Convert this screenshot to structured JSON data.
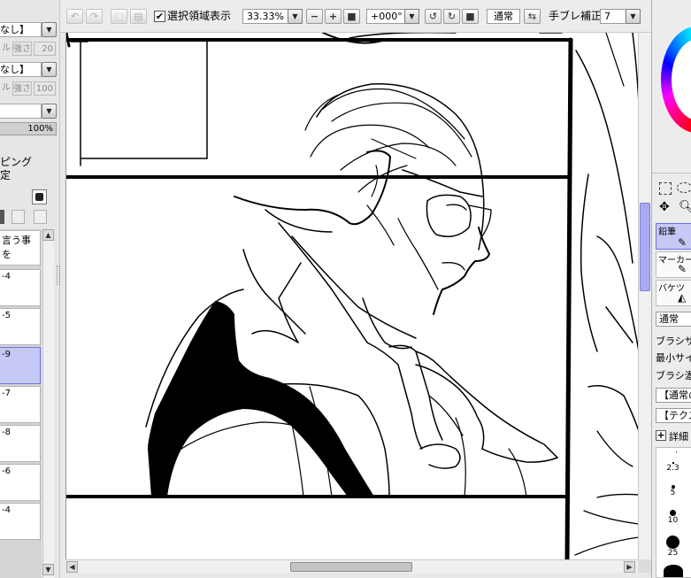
{
  "toolbar": {
    "show_selection_label": "選択領域表示",
    "zoom_value": "33.33%",
    "rotation_value": "+000°",
    "blend_mode": "通常",
    "stabilizer_label": "手ブレ補正",
    "stabilizer_value": "7"
  },
  "left_panel": {
    "texture_select": "なし】",
    "texture_strength_label": "強さ",
    "texture_strength_value": "20",
    "effect_select": "なし】",
    "effect_strength_label": "強さ",
    "effect_strength_value": "100",
    "blend_select": "",
    "opacity_value": "100%",
    "clipping_label": "ピング",
    "selection_source_label": "定",
    "layers": [
      {
        "name": "言う事を",
        "selected": false
      },
      {
        "name": "-4",
        "selected": false
      },
      {
        "name": "-5",
        "selected": false
      },
      {
        "name": "-9",
        "selected": true
      },
      {
        "name": "-7",
        "selected": false
      },
      {
        "name": "-8",
        "selected": false
      },
      {
        "name": "-6",
        "selected": false
      },
      {
        "name": "-4",
        "selected": false
      }
    ]
  },
  "right_panel": {
    "brushes": [
      {
        "name": "鉛筆",
        "selected": true
      },
      {
        "name": "マーカー",
        "selected": false
      },
      {
        "name": "バケツ",
        "selected": false
      }
    ],
    "blend_mode": "通常",
    "brush_size_label": "ブラシサイ",
    "min_size_label": "最小サイ",
    "brush_density_label": "ブラシ濃",
    "normal_circle_select": "【通常の",
    "texture_select": "【テクス",
    "advanced_label": "詳細",
    "size_presets": [
      {
        "label": "",
        "dot": 1
      },
      {
        "label": "2.3",
        "dot": 2
      },
      {
        "label": "5",
        "dot": 4
      },
      {
        "label": "10",
        "dot": 7
      },
      {
        "label": "25",
        "dot": 15
      }
    ]
  },
  "colors": {
    "selected_layer_bg": "#c6c9f6",
    "scroll_thumb": "#a9a9f1",
    "canvas_bg": "#ffffff"
  }
}
